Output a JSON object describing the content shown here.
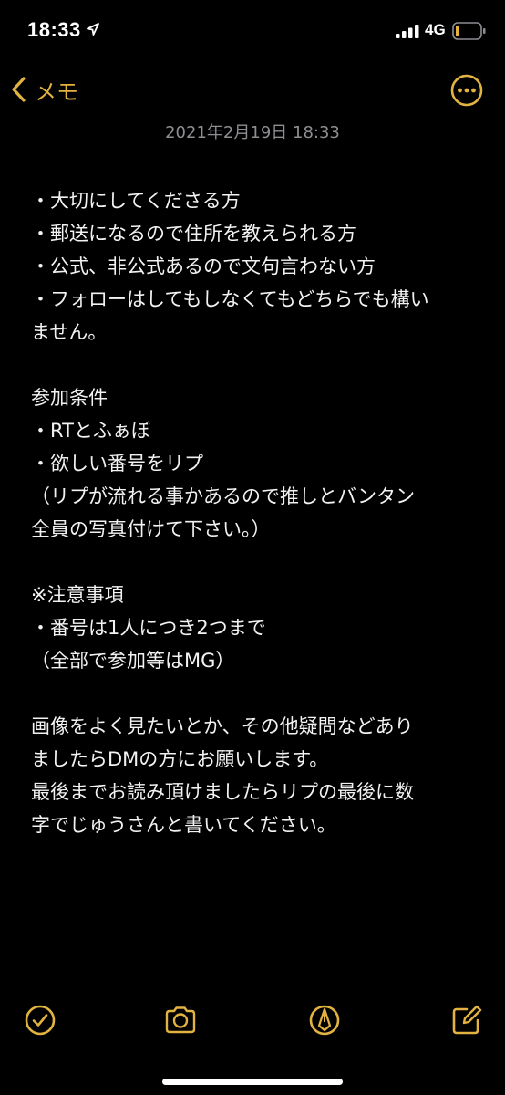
{
  "status_bar": {
    "time": "18:33",
    "network": "4G"
  },
  "nav": {
    "back_label": "メモ",
    "more_icon": "ellipsis-circle-icon"
  },
  "note": {
    "date": "2021年2月19日 18:33",
    "lines": [
      "・大切にしてくださる方",
      "・郵送になるので住所を教えられる方",
      "・公式、非公式あるので文句言わない方",
      "・フォローはしてもしなくてもどちらでも構い",
      "ません。",
      "",
      "参加条件",
      "・RTとふぁぼ",
      "・欲しい番号をリプ",
      "（リプが流れる事かあるので推しとバンタン",
      "全員の写真付けて下さい。）",
      "",
      "※注意事項",
      "・番号は1人につき2つまで",
      "（全部で参加等はMG）",
      "",
      "画像をよく見たいとか、その他疑問などあり",
      "ましたらDMの方にお願いします。",
      "最後までお読み頂けましたらリプの最後に数",
      "字でじゅうさんと書いてください。"
    ]
  },
  "toolbar": {
    "icons": [
      "checklist-icon",
      "camera-icon",
      "markup-pen-icon",
      "compose-icon"
    ]
  },
  "colors": {
    "accent": "#e3b341",
    "background": "#000000",
    "text": "#f2f2f2",
    "secondary_text": "#8e8e93"
  }
}
